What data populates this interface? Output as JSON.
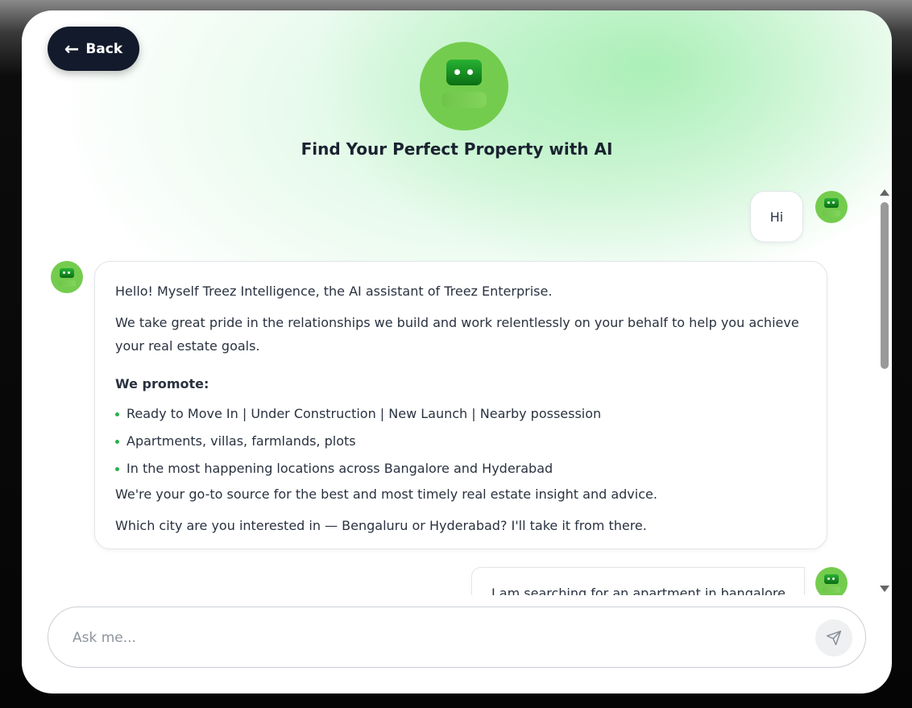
{
  "header": {
    "back_label": "Back",
    "title": "Find Your Perfect Property with AI"
  },
  "messages": [
    {
      "role": "user",
      "text": "Hi"
    },
    {
      "role": "bot",
      "greeting": "Hello! Myself Treez Intelligence, the AI assistant of Treez Enterprise.",
      "intro": "We take great pride in the relationships we build and work relentlessly on your behalf to help you achieve your real estate goals.",
      "promote_heading": "We promote:",
      "bullets": [
        "Ready to Move In | Under Construction | New Launch | Nearby possession",
        "Apartments, villas, farmlands, plots",
        "In the most happening locations across Bangalore and Hyderabad"
      ],
      "source_line": "We're your go-to source for the best and most timely real estate insight and advice.",
      "question": "Which city are you interested in — Bengaluru or Hyderabad? I'll take it from there."
    },
    {
      "role": "user",
      "text": "I am searching for an apartment in bangalore"
    }
  ],
  "composer": {
    "placeholder": "Ask me...",
    "send_icon": "send-icon"
  },
  "colors": {
    "accent_green": "#74cc4e",
    "back_button_bg": "#121a2b",
    "bullet_green": "#2bb04a"
  }
}
